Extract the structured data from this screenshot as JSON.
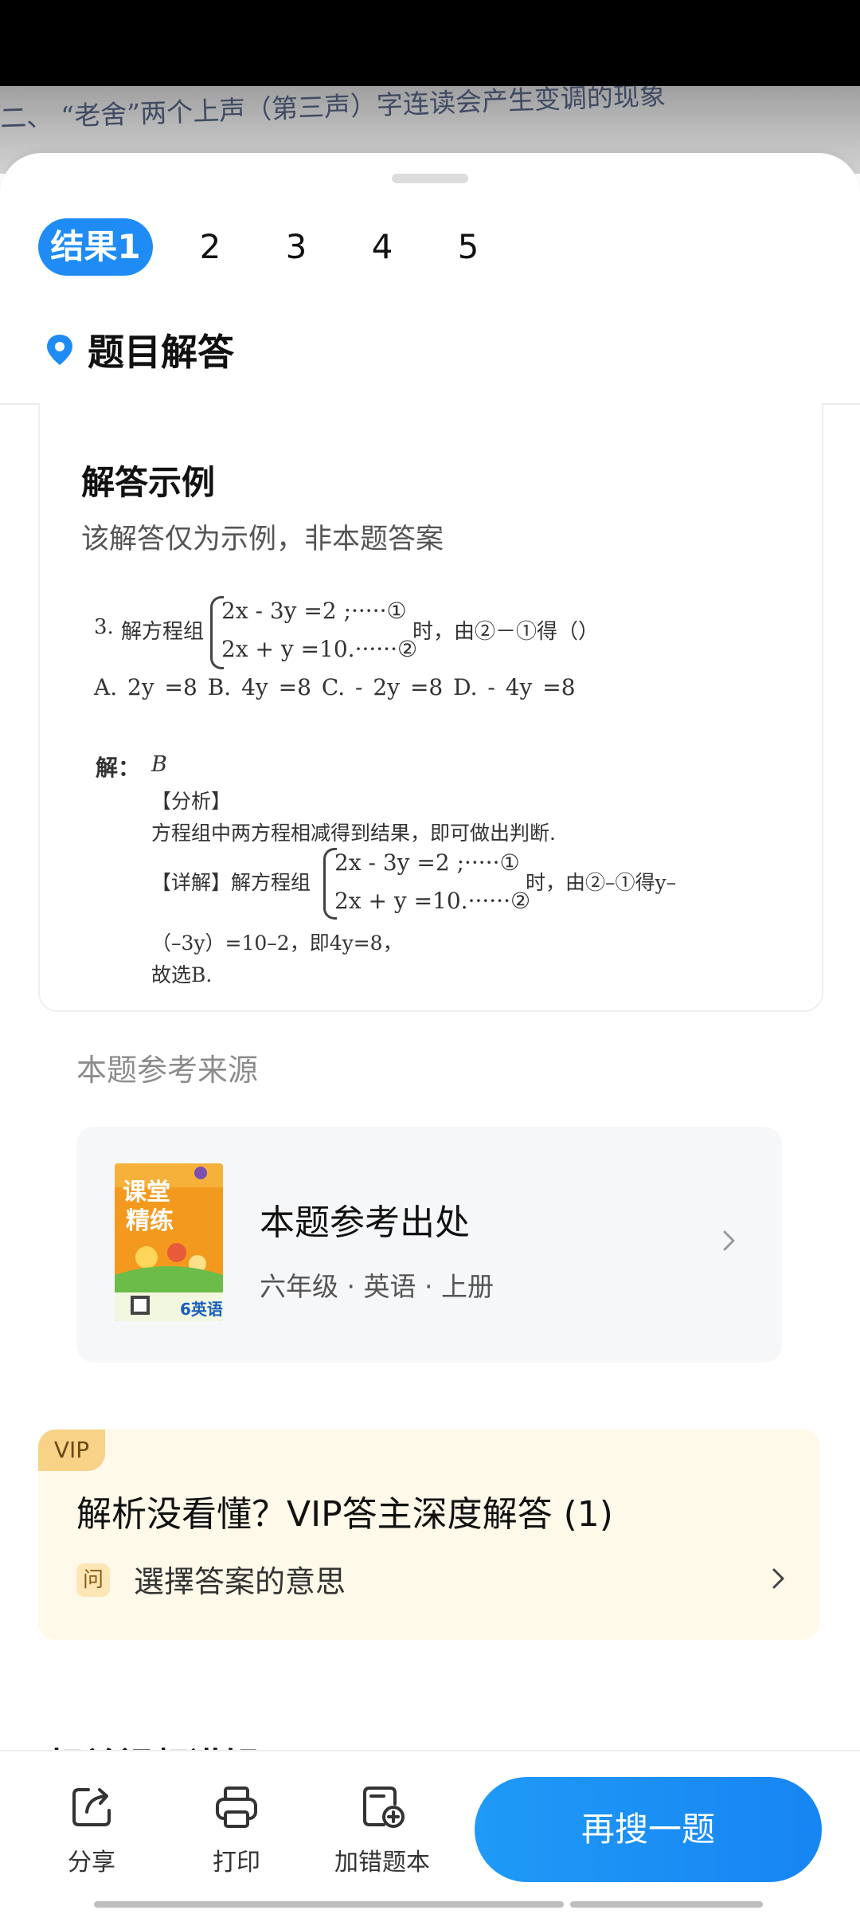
{
  "photo_strip": {
    "text": "二、 “老舍”两个上声（第三声）字连读会产生变调的现象"
  },
  "tabs": [
    "结果1",
    "2",
    "3",
    "4",
    "5"
  ],
  "section": {
    "title": "题目解答"
  },
  "answer_card": {
    "title": "解答示例",
    "note": "该解答仅为示例，非本题答案",
    "question": {
      "number": "3.",
      "prefix": "解方程组",
      "eq1": "2x - 3y =2 ;·····①",
      "eq2": "2x + y =10.······②",
      "suffix": "时，由②－①得（）",
      "options": "A.  2y =8  B. 4y =8  C. - 2y =8  D. - 4y =8"
    },
    "solution": {
      "label": "解：",
      "answer": "B",
      "analysis_label": "【分析】",
      "analysis_text": "方程组中两方程相减得到结果，即可做出判断.",
      "detail_label": "【详解】解方程组",
      "detail_eq1": "2x - 3y =2 ;·····①",
      "detail_eq2": "2x + y =10.······②",
      "detail_tail": "时，由②–①得y–",
      "line2": "（–3y）=10–2，即4y=8，",
      "line3": "故选B."
    }
  },
  "reference": {
    "heading": "本题参考来源",
    "title": "本题参考出处",
    "meta": "六年级 · 英语 · 上册",
    "book_cover_text_1": "课堂",
    "book_cover_text_2": "精练",
    "book_cover_grade": "6英语"
  },
  "vip": {
    "badge": "VIP",
    "title": "解析没看懂？VIP答主深度解答 (1)",
    "q_icon": "问",
    "q_text": "選擇答案的意思"
  },
  "clipped_text": "相关视频讲解",
  "toolbar": {
    "share_label": "分享",
    "print_label": "打印",
    "wrongbook_label": "加错题本",
    "search_again_label": "再搜一题"
  },
  "colors": {
    "accent": "#1f8cf5",
    "vip_bg": "#fff9ea",
    "vip_badge": "#f7d287"
  },
  "icons": [
    "location-pin-icon",
    "chevron-right-icon",
    "share-icon",
    "print-icon",
    "add-to-wrongbook-icon"
  ]
}
